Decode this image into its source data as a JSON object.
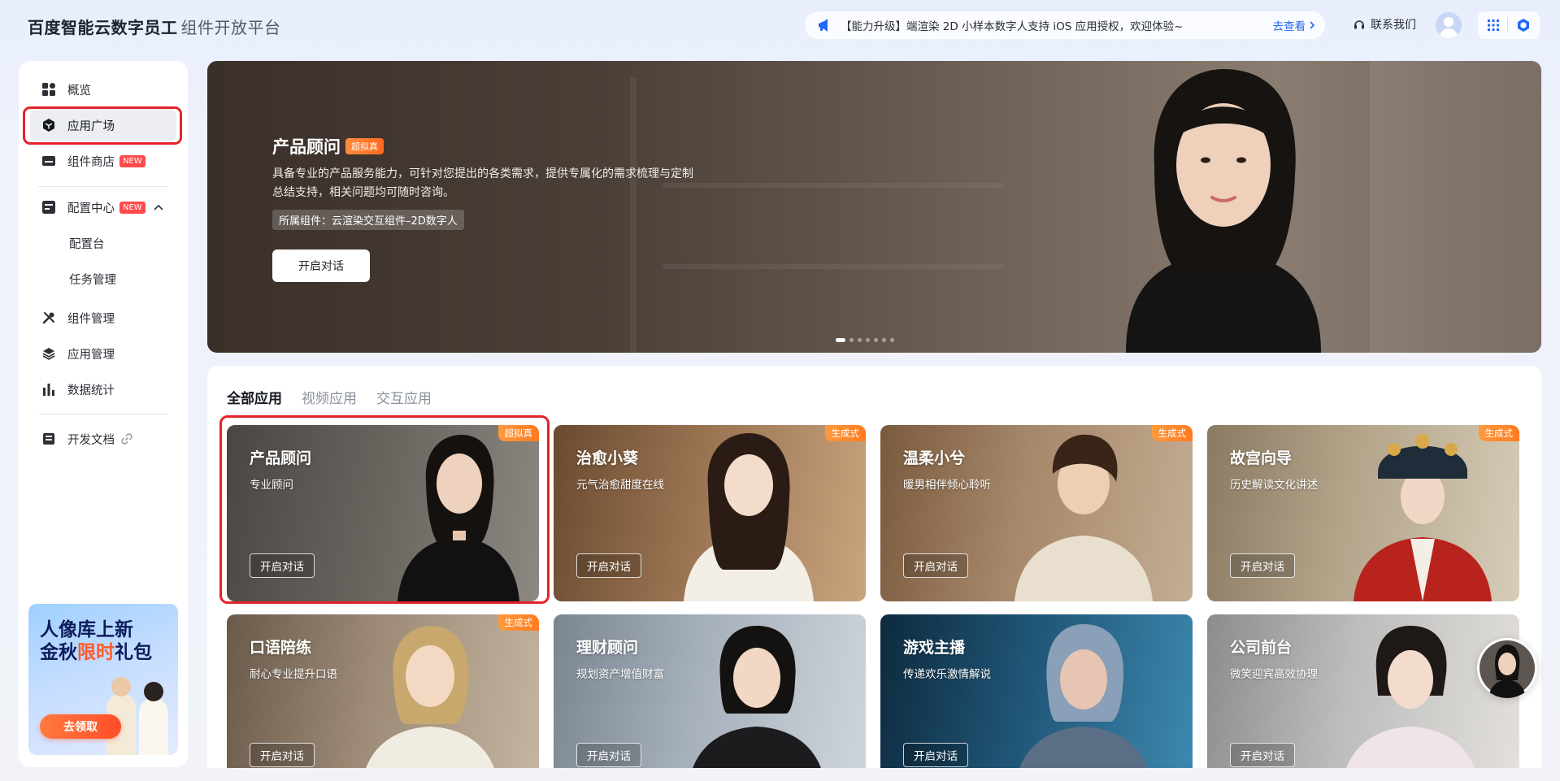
{
  "topbar": {
    "brand": "百度智能云数字员工",
    "brand_sub": "组件开放平台",
    "notice_text": "【能力升级】端渲染 2D 小样本数字人支持 iOS 应用授权，欢迎体验~",
    "notice_link": "去查看",
    "contact": "联系我们"
  },
  "sidebar": {
    "items": [
      {
        "label": "概览",
        "icon": "grid-icon"
      },
      {
        "label": "应用广场",
        "icon": "cube-icon"
      },
      {
        "label": "组件商店",
        "icon": "store-icon",
        "badge": "NEW"
      },
      {
        "label": "配置中心",
        "icon": "config-icon",
        "badge": "NEW"
      },
      {
        "label": "配置台"
      },
      {
        "label": "任务管理"
      },
      {
        "label": "组件管理",
        "icon": "tools-icon"
      },
      {
        "label": "应用管理",
        "icon": "layers-icon"
      },
      {
        "label": "数据统计",
        "icon": "bar-chart-icon"
      },
      {
        "label": "开发文档",
        "icon": "doc-icon"
      }
    ],
    "promo": {
      "line1": "人像库上新",
      "line2a": "金秋",
      "line2b": "限时",
      "line2c": "礼包",
      "button": "去领取"
    }
  },
  "hero": {
    "title": "产品顾问",
    "tag": "超拟真",
    "desc": "具备专业的产品服务能力，可针对您提出的各类需求，提供专属化的需求梳理与定制总结支持，相关问题均可随时咨询。",
    "component": "所属组件：云渲染交互组件–2D数字人",
    "button": "开启对话"
  },
  "apps": {
    "tabs": [
      "全部应用",
      "视频应用",
      "交互应用"
    ],
    "cards": [
      {
        "title": "产品顾问",
        "sub": "专业顾问",
        "tag": "超拟真",
        "button": "开启对话"
      },
      {
        "title": "治愈小葵",
        "sub": "元气治愈甜度在线",
        "tag": "生成式",
        "button": "开启对话"
      },
      {
        "title": "温柔小兮",
        "sub": "暖男相伴倾心聆听",
        "tag": "生成式",
        "button": "开启对话"
      },
      {
        "title": "故宫向导",
        "sub": "历史解读文化讲述",
        "tag": "生成式",
        "button": "开启对话"
      },
      {
        "title": "口语陪练",
        "sub": "耐心专业提升口语",
        "tag": "生成式",
        "button": "开启对话"
      },
      {
        "title": "理财顾问",
        "sub": "规划资产增值财富",
        "tag": "",
        "button": "开启对话"
      },
      {
        "title": "游戏主播",
        "sub": "传递欢乐激情解说",
        "tag": "",
        "button": "开启对话"
      },
      {
        "title": "公司前台",
        "sub": "微笑迎宾高效协理",
        "tag": "",
        "button": "开启对话"
      }
    ]
  },
  "colors": {
    "accent": "#2468f2",
    "highlight": "#e5222a",
    "tag_orange": "#ff7a1f",
    "badge_red": "#ff4b4b"
  }
}
